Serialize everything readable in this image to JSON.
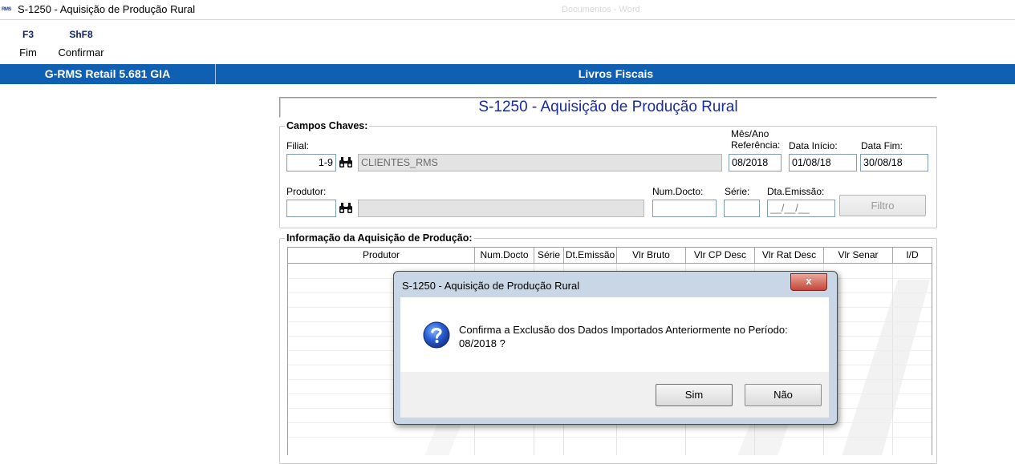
{
  "window": {
    "logo_text": "RMS",
    "title": "S-1250 - Aquisição de Produção Rural",
    "ghost_text": "Documentos - Word"
  },
  "toolbar": {
    "keys": [
      {
        "key": "F3",
        "label": "Fim"
      },
      {
        "key": "ShF8",
        "label": "Confirmar"
      }
    ]
  },
  "bluebar": {
    "system": "G-RMS Retail 5.681 GIA",
    "module": "Livros Fiscais"
  },
  "form": {
    "title": "S-1250 - Aquisição de Produção Rural",
    "campos_chaves": {
      "group_label": "Campos Chaves:",
      "filial_label": "Filial:",
      "filial_value": "1-9",
      "filial_name": "CLIENTES_RMS",
      "mes_ano_label_1": "Mês/Ano",
      "mes_ano_label_2": "Referência:",
      "mes_ano_value": "08/2018",
      "data_inicio_label": "Data Início:",
      "data_inicio_value": "01/08/18",
      "data_fim_label": "Data Fim:",
      "data_fim_value": "30/08/18",
      "produtor_label": "Produtor:",
      "produtor_value": "",
      "produtor_name": "",
      "num_docto_label": "Num.Docto:",
      "num_docto_value": "",
      "serie_label": "Série:",
      "serie_value": "",
      "dta_emissao_label": "Dta.Emissão:",
      "dta_emissao_value": "__/__/__",
      "filtro_label": "Filtro"
    },
    "informacao": {
      "group_label": "Informação da Aquisição de Produção:",
      "columns": [
        "Produtor",
        "Num.Docto",
        "Série",
        "Dt.Emissão",
        "Vlr Bruto",
        "Vlr CP Desc",
        "Vlr Rat Desc",
        "Vlr Senar",
        "I/D"
      ]
    }
  },
  "dialog": {
    "title": "S-1250 - Aquisição de Produção Rural",
    "close_label": "x",
    "icon": "question-icon",
    "message_line1": "Confirma a Exclusão dos Dados Importados Anteriormente no Período:",
    "message_line2": "08/2018 ?",
    "yes_label": "Sim",
    "no_label": "Não"
  },
  "colors": {
    "bluebar": "#0f5fb3",
    "form_title": "#1a2aa0",
    "function_key": "#0f1f6b"
  }
}
